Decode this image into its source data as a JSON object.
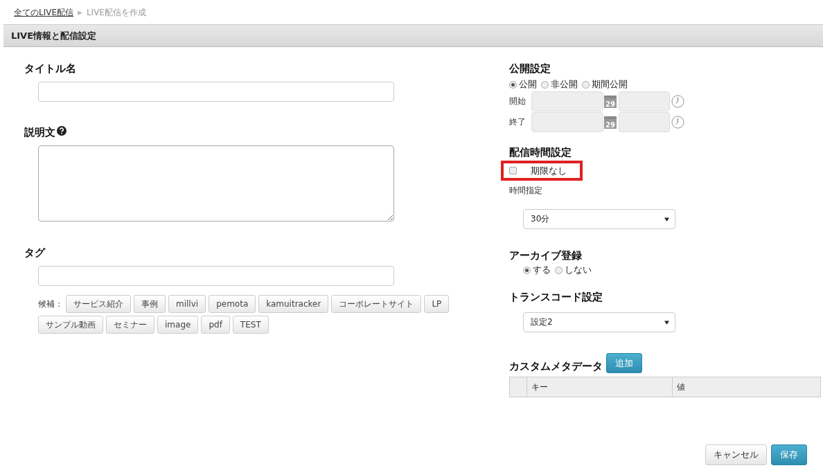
{
  "breadcrumb": {
    "link": "全てのLIVE配信",
    "separator": "▶",
    "current": "LIVE配信を作成"
  },
  "section_header": "LIVE情報と配信設定",
  "title_field": {
    "label": "タイトル名"
  },
  "description_field": {
    "label": "説明文"
  },
  "tag_field": {
    "label": "タグ",
    "candidates_label": "候補：",
    "candidates": [
      "サービス紹介",
      "事例",
      "millvi",
      "pemota",
      "kamuitracker",
      "コーポレートサイト",
      "LP",
      "サンプル動画",
      "セミナー",
      "image",
      "pdf",
      "TEST"
    ]
  },
  "publish": {
    "label": "公開設定",
    "options": [
      {
        "label": "公開",
        "selected": true
      },
      {
        "label": "非公開",
        "selected": false
      },
      {
        "label": "期間公開",
        "selected": false
      }
    ],
    "date_rows": [
      {
        "label": "開始",
        "calendar_day": "29"
      },
      {
        "label": "終了",
        "calendar_day": "29"
      }
    ]
  },
  "delivery_time": {
    "label": "配信時間設定",
    "no_limit": {
      "label": "期限なし",
      "checked": false
    },
    "time_label": "時間指定",
    "time_value": "30分"
  },
  "archive": {
    "label": "アーカイブ登録",
    "options": [
      {
        "label": "する",
        "selected": true
      },
      {
        "label": "しない",
        "selected": false
      }
    ]
  },
  "transcode": {
    "label": "トランスコード設定",
    "value": "設定2"
  },
  "custom_meta": {
    "label": "カスタムメタデータ",
    "add_button": "追加",
    "columns": [
      "キー",
      "値"
    ]
  },
  "buttons": {
    "cancel": "キャンセル",
    "save": "保存"
  }
}
